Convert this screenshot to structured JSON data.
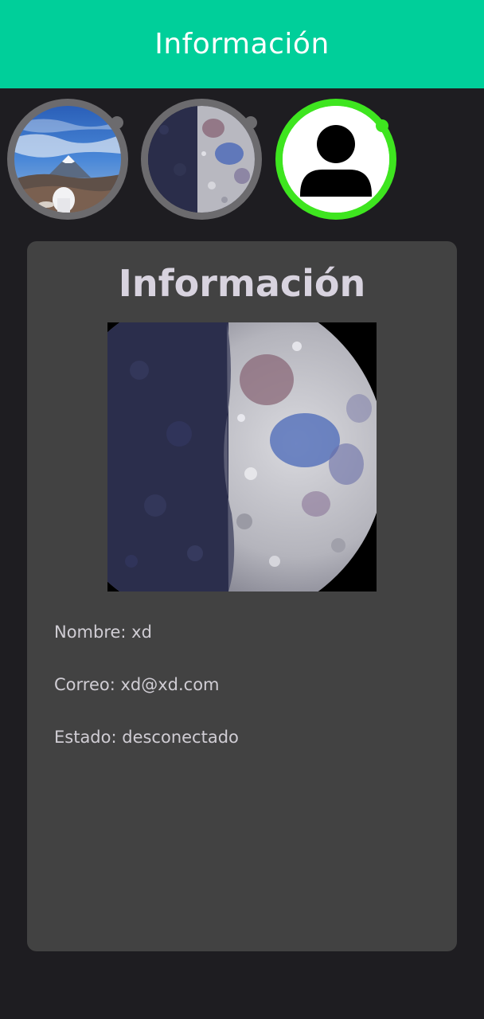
{
  "appbar": {
    "title": "Información",
    "color": "#00cf9a"
  },
  "avatars": [
    {
      "name": "mountain-photo",
      "ring_color": "#6c6b6e",
      "status": "offline"
    },
    {
      "name": "moon-photo",
      "ring_color": "#6c6b6e",
      "status": "offline"
    },
    {
      "name": "default-user",
      "ring_color": "#3ee51f",
      "status": "online",
      "selected": true
    }
  ],
  "card": {
    "title": "Información",
    "photo_icon": "moon-photo",
    "fields": {
      "nombre": "Nombre: xd",
      "correo": "Correo: xd@xd.com",
      "estado": "Estado: desconectado"
    }
  },
  "colors": {
    "background": "#1e1d21",
    "card": "#424242",
    "online": "#3ee51f",
    "offline_ring": "#6c6b6e"
  }
}
